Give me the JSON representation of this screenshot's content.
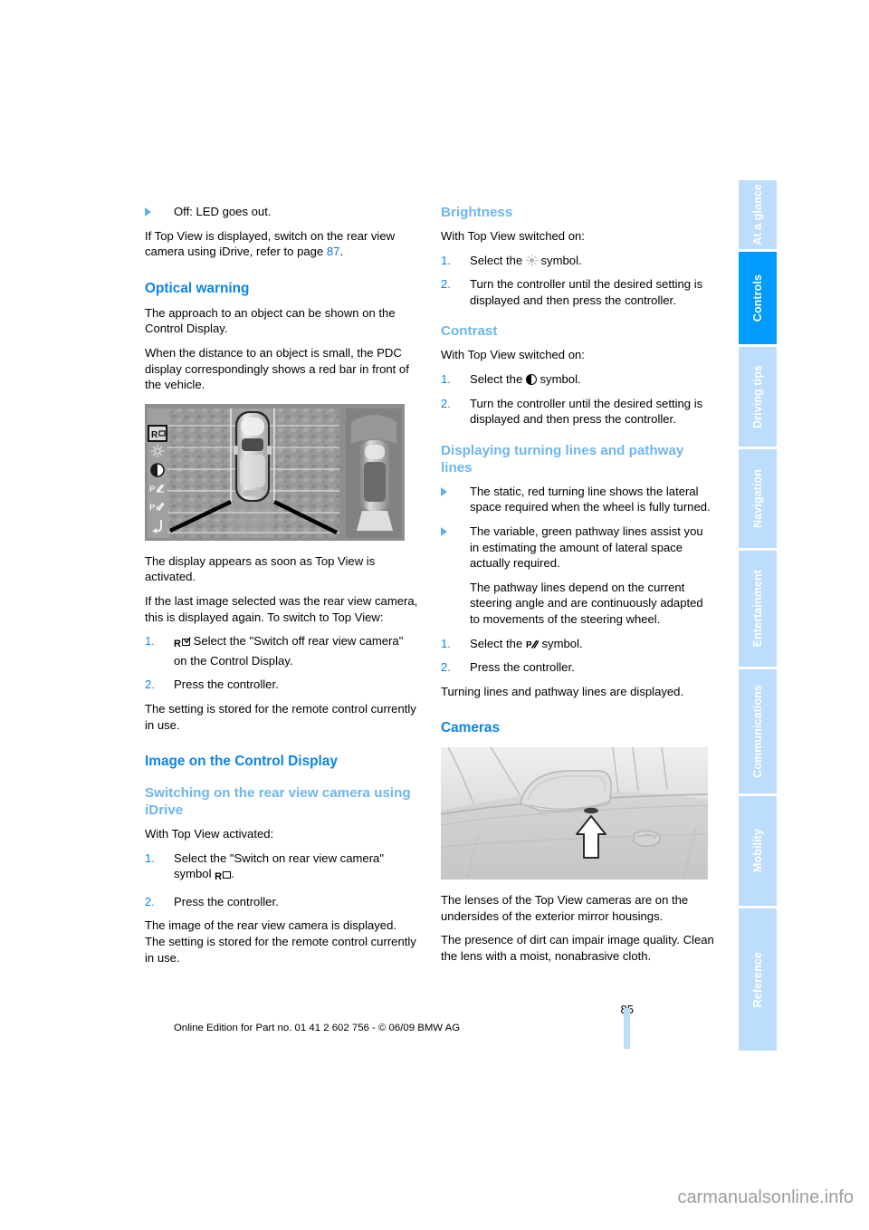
{
  "document": {
    "page_number": "85",
    "footer_note": "Online Edition for Part no. 01 41 2 602 756 - © 06/09 BMW AG",
    "watermark": "carmanualsonline.info"
  },
  "sidebar": {
    "tabs": [
      {
        "label": "At a glance",
        "active": false
      },
      {
        "label": "Controls",
        "active": true
      },
      {
        "label": "Driving tips",
        "active": false
      },
      {
        "label": "Navigation",
        "active": false
      },
      {
        "label": "Entertainment",
        "active": false
      },
      {
        "label": "Communications",
        "active": false
      },
      {
        "label": "Mobility",
        "active": false
      },
      {
        "label": "Reference",
        "active": false
      }
    ],
    "active_color": "#009bff",
    "inactive_color": "#bcddfb"
  },
  "left_column": {
    "bullet_off": "Off: LED goes out.",
    "top_view_note_a": "If Top View is displayed, switch on the rear view camera using iDrive, refer to page ",
    "top_view_note_link": "87",
    "top_view_note_b": ".",
    "optical_warning_heading": "Optical warning",
    "optical_p1": "The approach to an object can be shown on the Control Display.",
    "optical_p2": "When the distance to an object is small, the PDC display correspondingly shows a red bar in front of the vehicle.",
    "fig_caption_p1": "The display appears as soon as Top View is activated.",
    "fig_caption_p2": "If the last image selected was the rear view camera, this is displayed again. To switch to Top View:",
    "step1": "Select the \"Switch off rear view camera\" on the Control Display.",
    "step2": "Press the controller.",
    "stored_note": "The setting is stored for the remote control currently in use.",
    "image_heading": "Image on the Control Display",
    "switching_subheading": "Switching on the rear view camera using iDrive",
    "with_top_view_activated": "With Top View activated:",
    "idrive_step1_a": "Select the \"Switch on rear view camera\" symbol ",
    "idrive_step1_b": ".",
    "idrive_step2": "Press the controller.",
    "idrive_result": "The image of the rear view camera is displayed. The setting is stored for the remote control currently in use."
  },
  "right_column": {
    "brightness_heading": "Brightness",
    "brightness_intro": "With Top View switched on:",
    "brightness_step1_a": "Select the ",
    "brightness_step1_b": " symbol.",
    "brightness_step2": "Turn the controller until the desired setting is displayed and then press the controller.",
    "contrast_heading": "Contrast",
    "contrast_intro": "With Top View switched on:",
    "contrast_step1_a": "Select the ",
    "contrast_step1_b": " symbol.",
    "contrast_step2": "Turn the controller until the desired setting is displayed and then press the controller.",
    "turning_heading": "Displaying turning lines and pathway lines",
    "turning_bullet1": "The static, red turning line shows the lateral space required when the wheel is fully turned.",
    "turning_bullet2": "The variable, green pathway lines assist you in estimating the amount of lateral space actually required.",
    "turning_bullet2_cont": "The pathway lines depend on the current steering angle and are continuously adapted to movements of the steering wheel.",
    "turning_step1_a": "Select the ",
    "turning_step1_b": " symbol.",
    "turning_step2": "Press the controller.",
    "turning_result": "Turning lines and pathway lines are displayed.",
    "cameras_heading": "Cameras",
    "cameras_p1": "The lenses of the Top View cameras are on the undersides of the exterior mirror housings.",
    "cameras_p2": "The presence of dirt can impair image quality. Clean the lens with a moist, nonabrasive cloth."
  },
  "figures": {
    "pdc_display": {
      "name": "top-view-pdc-display",
      "icons": [
        "rear-view-camera-icon",
        "brightness-icon",
        "contrast-icon",
        "pathway-lines-icon",
        "turning-lines-icon",
        "curved-arrow-icon"
      ]
    },
    "camera_photo": {
      "name": "exterior-mirror-camera-photo"
    }
  }
}
